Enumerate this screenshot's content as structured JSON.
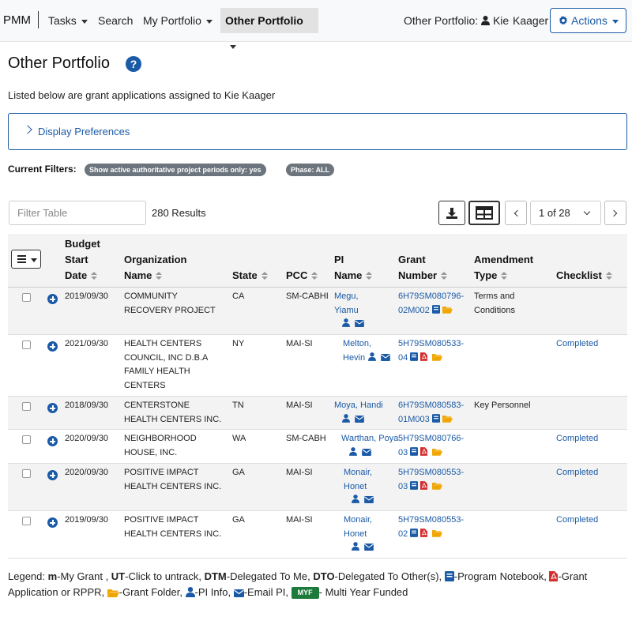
{
  "nav": {
    "brand": "PMM",
    "tasks": "Tasks",
    "search": "Search",
    "my_portfolio": "My Portfolio",
    "other_portfolio": "Other Portfolio",
    "portfolio_label": "Other Portfolio:",
    "user_first": "Kie",
    "user_last": "Kaager",
    "actions": "Actions"
  },
  "page": {
    "title": "Other Portfolio",
    "help": "?",
    "subtitle": "Listed below are grant applications assigned to Kie  Kaager",
    "display_prefs": "Display Preferences"
  },
  "filters": {
    "label": "Current Filters:",
    "badges": [
      "Show active authoritative project periods only: yes",
      "Phase: ALL"
    ]
  },
  "toolbar": {
    "filter_placeholder": "Filter Table",
    "results": "280 Results",
    "page_select": "1 of 28"
  },
  "table": {
    "headers": {
      "budget_1": "Budget",
      "budget_2": "Start",
      "budget_3": "Date",
      "org_1": "Organization",
      "org_2": "Name",
      "state": "State",
      "pcc": "PCC",
      "pi_1": "PI",
      "pi_2": "Name",
      "grant_1": "Grant",
      "grant_2": "Number",
      "amend_1": "Amendment",
      "amend_2": "Type",
      "checklist": "Checklist"
    },
    "rows": [
      {
        "date": "2019/09/30",
        "org_1": "COMMUNITY",
        "org_2": "RECOVERY PROJECT",
        "org_3": "",
        "org_4": "",
        "state": "CA",
        "pcc": "SM-CABHI",
        "pi_1": "Megu,",
        "pi_2": "Yiamu",
        "grant_1": "6H79SM080796-",
        "grant_2": "02M002",
        "amend_1": "Terms and",
        "amend_2": "Conditions",
        "checklist": ""
      },
      {
        "date": "2021/09/30",
        "org_1": "HEALTH CENTERS",
        "org_2": "COUNCIL, INC D.B.A",
        "org_3": "FAMILY  HEALTH",
        "org_4": "CENTERS",
        "state": "NY",
        "pcc": "MAI-SI",
        "pi_1": "Melton,",
        "pi_2": "Hevin",
        "grant_1": "5H79SM080533-",
        "grant_2": "04",
        "amend_1": "",
        "amend_2": "",
        "checklist": "Completed"
      },
      {
        "date": "2018/09/30",
        "org_1": "CENTERSTONE",
        "org_2": "HEALTH CENTERS INC.",
        "org_3": "",
        "org_4": "",
        "state": "TN",
        "pcc": "MAI-SI",
        "pi_1": "Moya,  Handi",
        "pi_2": "",
        "grant_1": "6H79SM080583-",
        "grant_2": "01M003",
        "amend_1": "Key Personnel",
        "amend_2": "",
        "checklist": ""
      },
      {
        "date": "2020/09/30",
        "org_1": "NEIGHBORHOOD",
        "org_2": "HOUSE, INC.",
        "org_3": "",
        "org_4": "",
        "state": "WA",
        "pcc": "SM-CABH",
        "pi_1": "Warthan, Poya",
        "pi_2": "",
        "grant_1": "5H79SM080766-",
        "grant_2": "03",
        "amend_1": "",
        "amend_2": "",
        "checklist": "Completed"
      },
      {
        "date": "2020/09/30",
        "org_1": "POSITIVE IMPACT",
        "org_2": "HEALTH CENTERS INC.",
        "org_3": "",
        "org_4": "",
        "state": "GA",
        "pcc": "MAI-SI",
        "pi_1": "Monair,",
        "pi_2": "Honet",
        "grant_1": "5H79SM080553-",
        "grant_2": "03",
        "amend_1": "",
        "amend_2": "",
        "checklist": "Completed"
      },
      {
        "date": "2019/09/30",
        "org_1": "POSITIVE IMPACT",
        "org_2": "HEALTH CENTERS INC.",
        "org_3": "",
        "org_4": "",
        "state": "GA",
        "pcc": "MAI-SI",
        "pi_1": "Monair,",
        "pi_2": "Honet",
        "grant_1": "5H79SM080553-",
        "grant_2": "02",
        "amend_1": "",
        "amend_2": "",
        "checklist": "Completed"
      }
    ]
  },
  "legend": {
    "prefix": "Legend: ",
    "m": "m",
    "m_text": "-My Grant , ",
    "ut": "UT",
    "ut_text": "-Click to untrack, ",
    "dtm": "DTM",
    "dtm_text": "-Delegated To Me, ",
    "dto": "DTO",
    "dto_text": "-Delegated To Other(s), ",
    "notebook_text": "-Program Notebook, ",
    "pdf_text": "-Grant Application or RPPR, ",
    "folder_text": "-Grant Folder, ",
    "pi_text": "-PI Info, ",
    "email_text": "-Email PI, ",
    "myf": "MYF",
    "myf_text": "- Multi Year Funded"
  },
  "colors": {
    "primary": "#1a5aa6",
    "folder": "#f0a500",
    "pdf": "#d32f2f",
    "myf": "#1d7a3a",
    "badge": "#6c757d"
  }
}
